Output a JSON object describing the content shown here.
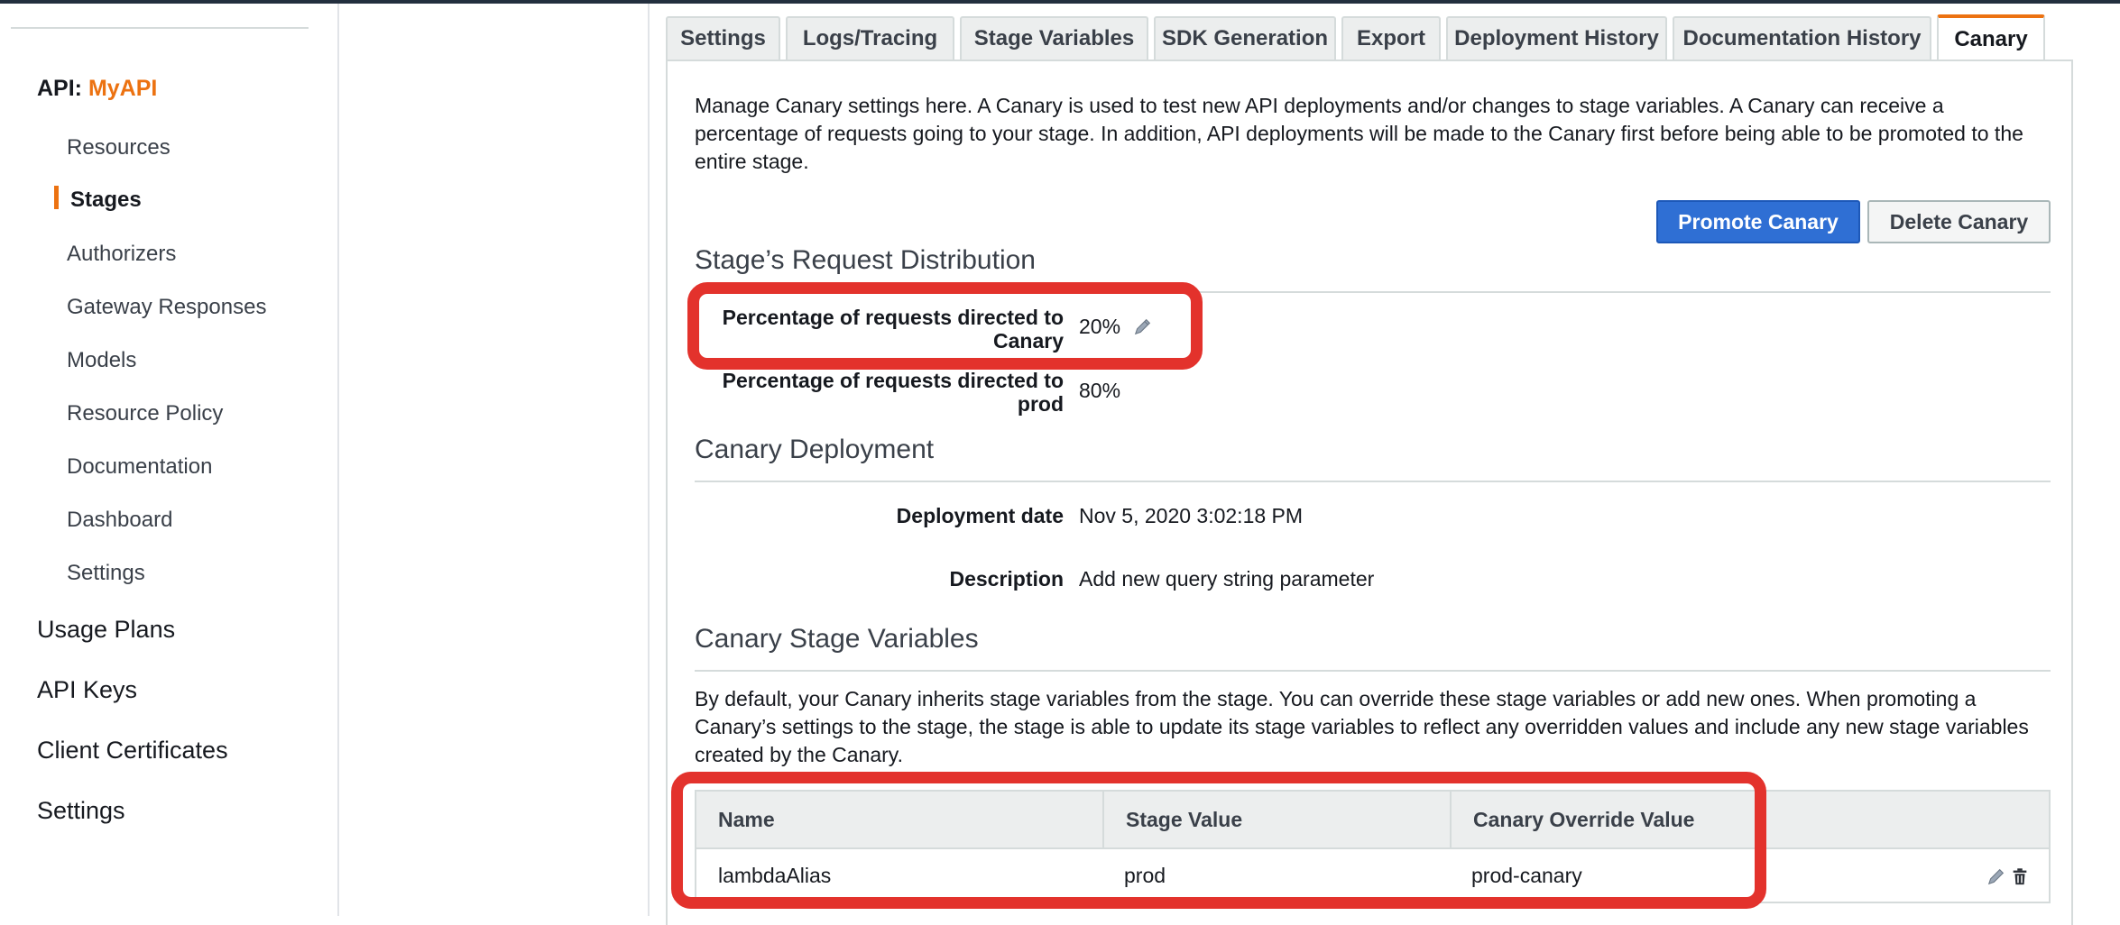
{
  "sidebar": {
    "api_prefix": "API:",
    "api_name": "MyAPI",
    "sub_items": [
      {
        "label": "Resources"
      },
      {
        "label": "Stages",
        "active": true
      },
      {
        "label": "Authorizers"
      },
      {
        "label": "Gateway Responses"
      },
      {
        "label": "Models"
      },
      {
        "label": "Resource Policy"
      },
      {
        "label": "Documentation"
      },
      {
        "label": "Dashboard"
      },
      {
        "label": "Settings"
      }
    ],
    "top_items": [
      {
        "label": "Usage Plans"
      },
      {
        "label": "API Keys"
      },
      {
        "label": "Client Certificates"
      },
      {
        "label": "Settings"
      }
    ]
  },
  "tabs": [
    {
      "label": "Settings"
    },
    {
      "label": "Logs/Tracing"
    },
    {
      "label": "Stage Variables"
    },
    {
      "label": "SDK Generation"
    },
    {
      "label": "Export"
    },
    {
      "label": "Deployment History"
    },
    {
      "label": "Documentation History"
    },
    {
      "label": "Canary",
      "active": true
    }
  ],
  "canary": {
    "intro": "Manage Canary settings here. A Canary is used to test new API deployments and/or changes to stage variables. A Canary can receive a percentage of requests going to your stage. In addition, API deployments will be made to the Canary first before being able to be promoted to the entire stage.",
    "promote_button": "Promote Canary",
    "delete_button": "Delete Canary",
    "distribution_title": "Stage’s Request Distribution",
    "canary_pct_label_line1": "Percentage of requests directed to",
    "canary_pct_label_line2": "Canary",
    "canary_pct_value": "20%",
    "prod_pct_label_line1": "Percentage of requests directed to",
    "prod_pct_label_line2": "prod",
    "prod_pct_value": "80%",
    "deployment_title": "Canary Deployment",
    "deployment_date_label": "Deployment date",
    "deployment_date_value": "Nov 5, 2020 3:02:18 PM",
    "description_label": "Description",
    "description_value": "Add new query string parameter",
    "variables_title": "Canary Stage Variables",
    "variables_text": "By default, your Canary inherits stage variables from the stage. You can override these stage variables or add new ones. When promoting a Canary’s settings to the stage, the stage is able to update its stage variables to reflect any overridden values and include any new stage variables created by the Canary.",
    "table": {
      "headers": [
        "Name",
        "Stage Value",
        "Canary Override Value"
      ],
      "rows": [
        {
          "name": "lambdaAlias",
          "stage_value": "prod",
          "override_value": "prod-canary"
        }
      ]
    }
  },
  "colors": {
    "accent": "#ec7211",
    "primary_button": "#2f6fd4",
    "highlight": "#e3322c"
  },
  "icons": {
    "edit": "pencil-icon",
    "delete": "trash-icon"
  }
}
